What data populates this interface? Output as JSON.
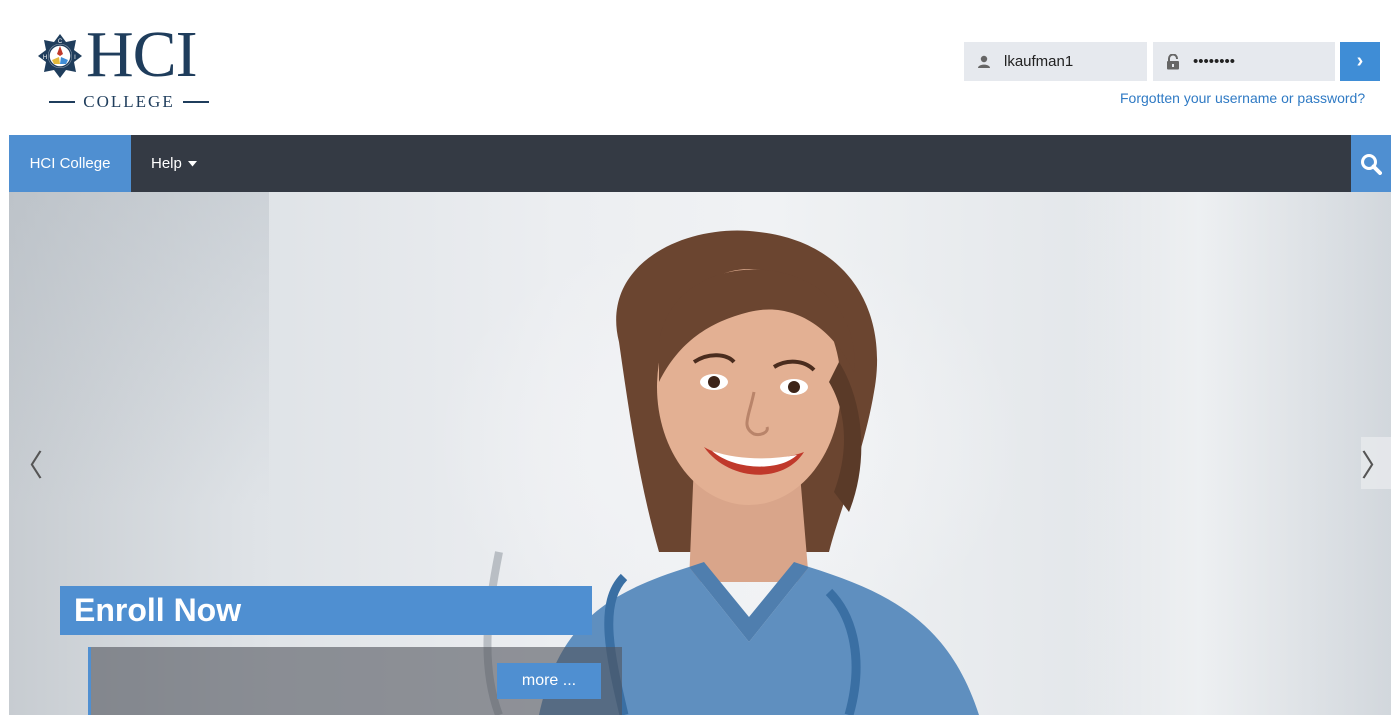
{
  "brand": {
    "logo_word": "HCI",
    "logo_sub": "COLLEGE",
    "crest_letters": [
      "C",
      "H",
      "I"
    ],
    "colors": {
      "navy": "#1f3d5c",
      "accent": "#4f8fd1",
      "nav_bg": "#343a44"
    }
  },
  "login": {
    "username_icon": "user-icon",
    "username_value": "lkaufman1",
    "password_icon": "lock-icon",
    "password_value": "••••••••",
    "submit_label": "›",
    "forgot_label": "Forgotten your username or password?"
  },
  "nav": {
    "home_label": "HCI College",
    "help_label": "Help",
    "help_icon": "caret-down-icon",
    "search_icon": "search-icon"
  },
  "carousel": {
    "prev_label": "〈",
    "next_label": "〉",
    "slide_title": "Enroll Now",
    "more_label": "more ..."
  }
}
